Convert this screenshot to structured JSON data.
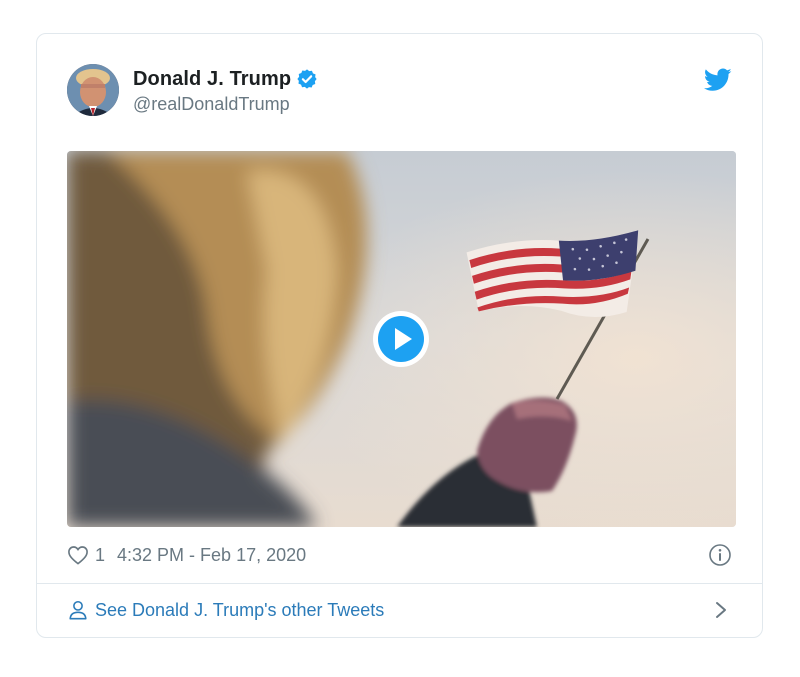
{
  "tweet": {
    "author_name": "Donald J. Trump",
    "author_handle": "@realDonaldTrump",
    "verified": true,
    "like_count": "1",
    "timestamp": "4:32 PM - Feb 17, 2020",
    "footer_link": "See Donald J. Trump's other Tweets"
  },
  "colors": {
    "accent": "#1da1f2",
    "link": "#2b7bb9",
    "secondary_text": "#697882",
    "border": "#e1e8ed"
  },
  "icons": {
    "verified": "verified-badge-icon",
    "twitter": "twitter-bird-icon",
    "play": "play-icon",
    "like": "heart-icon",
    "info": "info-icon",
    "person": "person-icon",
    "chevron": "chevron-right-icon"
  }
}
